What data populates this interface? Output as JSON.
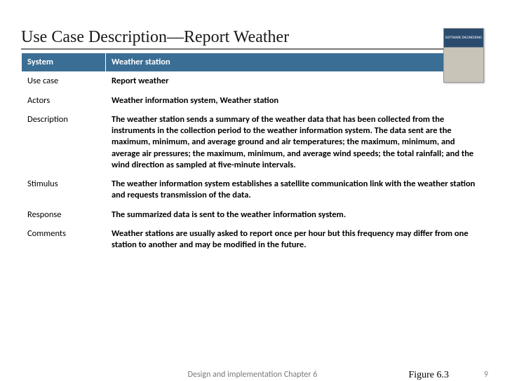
{
  "slide": {
    "title": "Use Case Description—Report Weather",
    "book_label": "SOFTWARE ENGINEERING",
    "table": {
      "headerRow": {
        "label": "System",
        "value": "Weather station"
      },
      "rows": [
        {
          "label": "Use case",
          "value": "Report weather"
        },
        {
          "label": "Actors",
          "value": "Weather information system, Weather station"
        },
        {
          "label": "Description",
          "value": "The weather station sends a summary of the weather data that has been collected from the instruments in the collection period to the weather information system. The data sent are the maximum, minimum, and average ground and air temperatures; the maximum, minimum, and average air pressures; the maximum, minimum, and average wind speeds; the total rainfall; and the wind direction as sampled at five-minute intervals."
        },
        {
          "label": "Stimulus",
          "value": "The weather information system establishes a satellite communication link with the weather station and requests transmission of the data."
        },
        {
          "label": "Response",
          "value": "The summarized data is sent to the weather information system."
        },
        {
          "label": "Comments",
          "value": "Weather stations are usually asked to report once per hour but this frequency may differ from one station to another and may be modified in the future."
        }
      ]
    },
    "footer": {
      "center": "Design and implementation    Chapter 6",
      "figure": "Figure 6.3",
      "page": "9"
    }
  }
}
